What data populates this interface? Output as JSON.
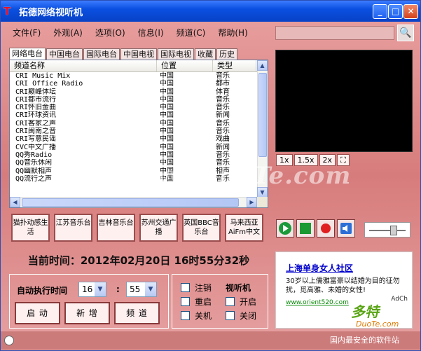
{
  "title": "拓德网络视听机",
  "menu": [
    "文件(F)",
    "外观(A)",
    "选项(O)",
    "信息(I)",
    "频道(C)",
    "帮助(H)"
  ],
  "tabs": [
    "网络电台",
    "中国电台",
    "国际电台",
    "中国电视",
    "国际电视",
    "收藏",
    "历史"
  ],
  "columns": [
    "频道名称",
    "位置",
    "类型"
  ],
  "rows": [
    [
      "CRI Music Mix",
      "中国",
      "音乐"
    ],
    [
      "CRI Office Radio",
      "中国",
      "都市"
    ],
    [
      "CRI巅峰体坛",
      "中国",
      "体育"
    ],
    [
      "CRI都市流行",
      "中国",
      "音乐"
    ],
    [
      "CRI怀旧金曲",
      "中国",
      "音乐"
    ],
    [
      "CRI环球资讯",
      "中国",
      "新闻"
    ],
    [
      "CRI客家之声",
      "中国",
      "音乐"
    ],
    [
      "CRI闽南之音",
      "中国",
      "音乐"
    ],
    [
      "CRI写意民谣",
      "中国",
      "戏曲"
    ],
    [
      "CVC中文广播",
      "中国",
      "新闻"
    ],
    [
      "QQ秀Radio",
      "中国",
      "音乐"
    ],
    [
      "QQ音乐休闲",
      "中国",
      "音乐"
    ],
    [
      "QQ幽默相声",
      "中国",
      "相声"
    ],
    [
      "QQ流行之声",
      "中国",
      "音乐"
    ]
  ],
  "quick": [
    "猫扑动感生活",
    "江苏音乐台",
    "吉林音乐台",
    "苏州交通广播",
    "英国BBC音乐台",
    "马来西亚AiFm中文"
  ],
  "zoom": [
    "1x",
    "1.5x",
    "2x"
  ],
  "time": "当前时间：2012年02月20日 16时55分32秒",
  "auto_label": "自动执行时间",
  "hour": "16",
  "minute": "55",
  "minute_sep": ":",
  "actions": [
    "启  动",
    "新  增",
    "频  道"
  ],
  "opt_header": "视听机",
  "opts_left": [
    "注销",
    "重启",
    "关机"
  ],
  "opts_right": [
    "开启",
    "关闭"
  ],
  "ad": {
    "title": "上海单身女人社区",
    "text": "30岁以上儒雅富豪以结婚为目的征勿扰，觅高雅、未婚的女性!",
    "url": "www.orient520.com",
    "ch": "AdCh"
  },
  "watermark": "www.DuoTe.com",
  "logo": {
    "a": "多特",
    "b": "DuoTe.com",
    "c": "国内最安全的软件站"
  }
}
